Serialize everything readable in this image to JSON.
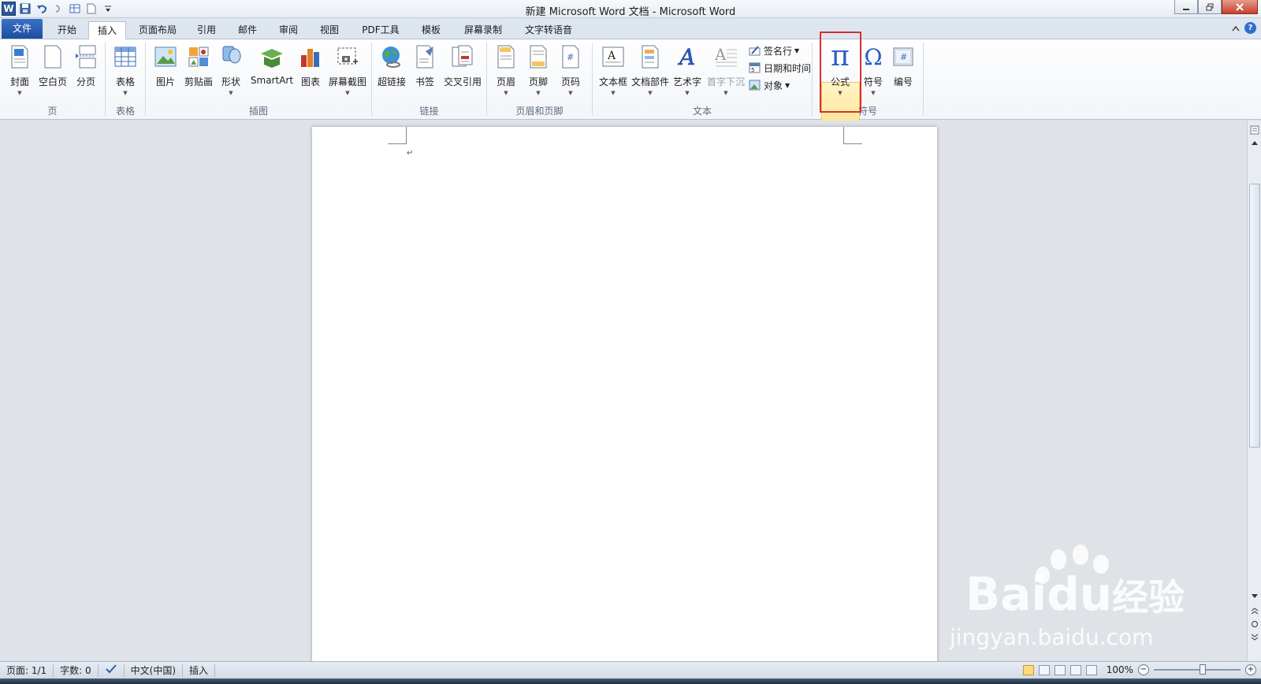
{
  "window": {
    "title": "新建 Microsoft Word 文档 - Microsoft Word",
    "app_icon": "W",
    "controls": [
      "minimize-icon",
      "restore-icon",
      "close-icon"
    ]
  },
  "quick_access": [
    "save-icon",
    "undo-icon",
    "redo-icon",
    "table-icon",
    "new-doc-icon",
    "customize-icon"
  ],
  "tabs": [
    {
      "label": "文件"
    },
    {
      "label": "开始"
    },
    {
      "label": "插入"
    },
    {
      "label": "页面布局"
    },
    {
      "label": "引用"
    },
    {
      "label": "邮件"
    },
    {
      "label": "审阅"
    },
    {
      "label": "视图"
    },
    {
      "label": "PDF工具"
    },
    {
      "label": "模板"
    },
    {
      "label": "屏幕录制"
    },
    {
      "label": "文字转语音"
    }
  ],
  "active_tab": "插入",
  "ribbon": {
    "groups": {
      "pages": "页",
      "tables": "表格",
      "illustrations": "插图",
      "links": "链接",
      "header_footer": "页眉和页脚",
      "text": "文本",
      "symbols": "符号"
    },
    "buttons": {
      "cover": "封面",
      "blank_page": "空白页",
      "page_break": "分页",
      "table": "表格",
      "picture": "图片",
      "clipart": "剪贴画",
      "shapes": "形状",
      "smartart": "SmartArt",
      "chart": "图表",
      "screenshot": "屏幕截图",
      "hyperlink": "超链接",
      "bookmark": "书签",
      "cross_ref": "交叉引用",
      "header": "页眉",
      "footer": "页脚",
      "page_number": "页码",
      "text_box": "文本框",
      "quick_parts": "文档部件",
      "wordart": "艺术字",
      "drop_cap": "首字下沉",
      "signature_line": "签名行",
      "date_time": "日期和时间",
      "object": "对象",
      "equation": "公式",
      "symbol": "符号",
      "numbering": "编号"
    },
    "glyphs": {
      "pi": "π",
      "omega": "Ω",
      "hash": "#",
      "a": "A"
    }
  },
  "document": {
    "paragraph_mark": "↵"
  },
  "statusbar": {
    "page": "页面: 1/1",
    "words": "字数: 0",
    "language": "中文(中国)",
    "mode": "插入",
    "zoom": "100%",
    "zoom_minus": "−",
    "zoom_plus": "+"
  },
  "watermark": {
    "brand": "Bai",
    "brand2": "du",
    "cn": "经验",
    "url": "jingyan.baidu.com"
  },
  "colors": {
    "accent": "#2b5797",
    "highlight_box": "#d62f2f",
    "pi_blue": "#2a5ec7"
  }
}
